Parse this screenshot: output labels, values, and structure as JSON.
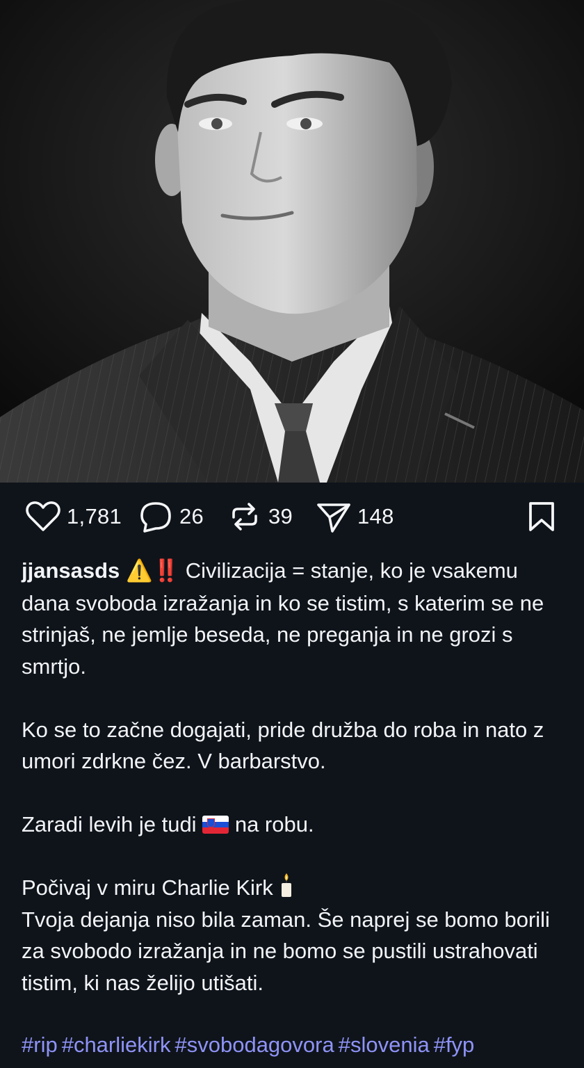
{
  "post": {
    "image": {
      "description_icon": "portrait-photo",
      "style": "black-and-white"
    },
    "actions": {
      "likes": "1,781",
      "comments": "26",
      "reposts": "39",
      "shares": "148"
    },
    "author": {
      "username": "jjansasds"
    },
    "caption": {
      "emoji_warning": "⚠️",
      "emoji_bang": "‼️",
      "line1": "Civilizacija = stanje, ko je vsakemu dana svoboda izražanja in ko se tistim, s katerim se ne strinjaš, ne jemlje beseda, ne preganja in ne grozi s smrtjo.",
      "para2": "Ko se to začne dogajati, pride družba do roba in nato z umori zdrkne čez. V barbarstvo.",
      "para3_before": "Zaradi levih je tudi",
      "para3_after": "na robu.",
      "para4_line1": "Počivaj v miru Charlie Kirk",
      "para4_rest": "Tvoja dejanja niso bila zaman. Še naprej se bomo borili za svobodo izražanja in ne bomo se pustili ustrahovati tistim, ki nas želijo utišati."
    },
    "hashtags": [
      "#rip",
      "#charliekirk",
      "#svobodagovora",
      "#slovenia",
      "#fyp"
    ]
  },
  "colors": {
    "background": "#0f141b",
    "text": "#f2f4f7",
    "hashtag": "#8f93f7"
  }
}
